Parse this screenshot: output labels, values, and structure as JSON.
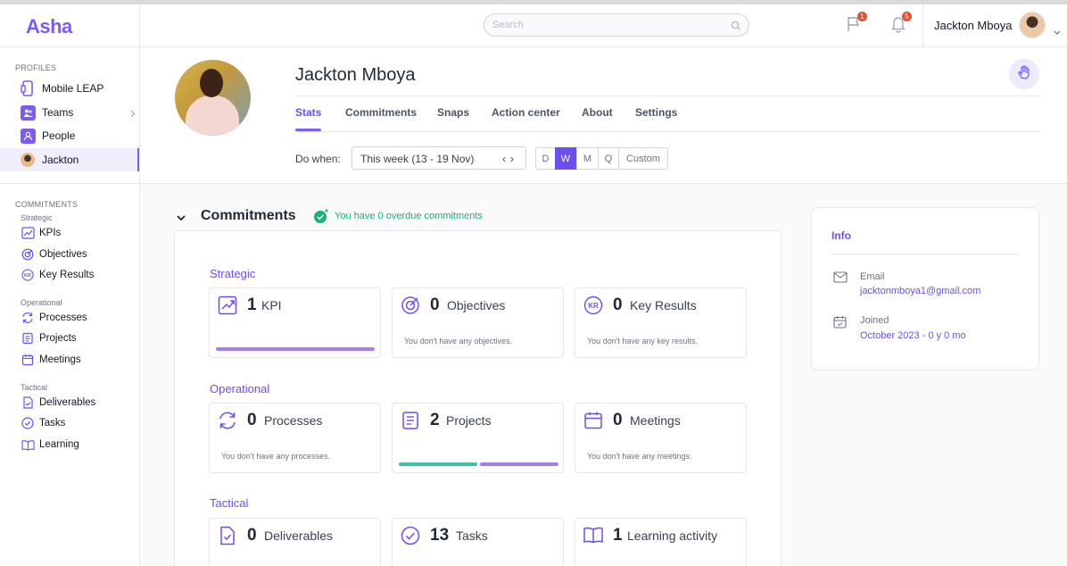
{
  "app": {
    "logo": "Asha"
  },
  "topbar": {
    "search_placeholder": "Search",
    "flag_badge": "1",
    "bell_badge": "5",
    "user_name": "Jackton Mboya"
  },
  "sidebar": {
    "profiles_title": "PROFILES",
    "profiles": [
      {
        "label": "Mobile LEAP"
      },
      {
        "label": "Teams"
      },
      {
        "label": "People"
      },
      {
        "label": "Jackton"
      }
    ],
    "commitments_title": "COMMITMENTS",
    "strategic_title": "Strategic",
    "strategic": [
      {
        "label": "KPIs"
      },
      {
        "label": "Objectives"
      },
      {
        "label": "Key Results"
      }
    ],
    "operational_title": "Operational",
    "operational": [
      {
        "label": "Processes"
      },
      {
        "label": "Projects"
      },
      {
        "label": "Meetings"
      }
    ],
    "tactical_title": "Tactical",
    "tactical": [
      {
        "label": "Deliverables"
      },
      {
        "label": "Tasks"
      },
      {
        "label": "Learning"
      }
    ]
  },
  "profile": {
    "name": "Jackton Mboya",
    "tabs": [
      {
        "label": "Stats"
      },
      {
        "label": "Commitments"
      },
      {
        "label": "Snaps"
      },
      {
        "label": "Action center"
      },
      {
        "label": "About"
      },
      {
        "label": "Settings"
      }
    ],
    "do_when_label": "Do when:",
    "week_value": "This week (13 - 19 Nov)",
    "period_options": [
      "D",
      "W",
      "M",
      "Q",
      "Custom"
    ],
    "period_selected": "W"
  },
  "commitments": {
    "title": "Commitments",
    "overdue_text": "You have 0 overdue commitments",
    "groups": [
      {
        "label": "Strategic",
        "cards": [
          {
            "count": "1",
            "name": "KPI",
            "empty": "",
            "progress": [
              1.0
            ]
          },
          {
            "count": "0",
            "name": "Objectives",
            "empty": "You don't have any objectives.",
            "progress": []
          },
          {
            "count": "0",
            "name": "Key Results",
            "empty": "You don't have any key results.",
            "progress": []
          }
        ]
      },
      {
        "label": "Operational",
        "cards": [
          {
            "count": "0",
            "name": "Processes",
            "empty": "You don't have any processes.",
            "progress": []
          },
          {
            "count": "2",
            "name": "Projects",
            "empty": "",
            "progress": [
              0.5,
              0.5
            ]
          },
          {
            "count": "0",
            "name": "Meetings",
            "empty": "You don't have any meetings.",
            "progress": []
          }
        ]
      },
      {
        "label": "Tactical",
        "cards": [
          {
            "count": "0",
            "name": "Deliverables",
            "empty": "",
            "progress": []
          },
          {
            "count": "13",
            "name": "Tasks",
            "empty": "",
            "progress": []
          },
          {
            "count": "1",
            "name": "Learning activity",
            "empty": "",
            "progress": []
          }
        ]
      }
    ]
  },
  "info": {
    "title": "Info",
    "email_label": "Email",
    "email_value": "jacktonmboya1@gmail.com",
    "joined_label": "Joined",
    "joined_value": "October 2023 - 0 y 0 mo"
  },
  "colors": {
    "accent": "#6d4ef0",
    "success": "#16b27a",
    "badge": "#e2522e",
    "teal": "#3ebfa8",
    "purple_bar": "#a67ef0"
  }
}
